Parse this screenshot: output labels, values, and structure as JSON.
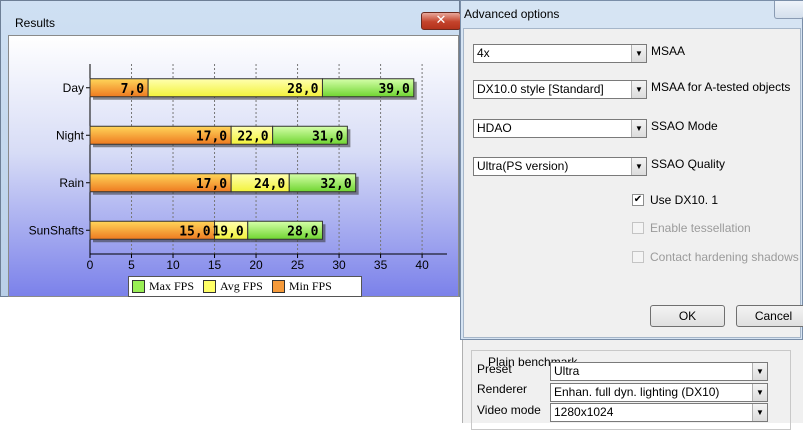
{
  "results_window": {
    "title": "Results",
    "close_glyph": "✕"
  },
  "chart_data": {
    "type": "bar",
    "orientation": "horizontal",
    "stacked": true,
    "categories": [
      "Day",
      "Night",
      "Rain",
      "SunShafts"
    ],
    "series": [
      {
        "name": "Min FPS",
        "values": [
          7.0,
          17.0,
          17.0,
          15.0
        ],
        "labels": [
          "7,0",
          "17,0",
          "17,0",
          "15,0"
        ],
        "color": "#f59a3a"
      },
      {
        "name": "Avg FPS",
        "values": [
          28.0,
          22.0,
          24.0,
          19.0
        ],
        "labels": [
          "28,0",
          "22,0",
          "24,0",
          "19,0"
        ],
        "color": "#ffff66"
      },
      {
        "name": "Max FPS",
        "values": [
          39.0,
          31.0,
          32.0,
          28.0
        ],
        "labels": [
          "39,0",
          "31,0",
          "32,0",
          "28,0"
        ],
        "color": "#99ee55"
      }
    ],
    "xlim": [
      0,
      43
    ],
    "xticks": [
      0,
      5,
      10,
      15,
      20,
      25,
      30,
      35,
      40
    ],
    "grid": true,
    "legend": {
      "position": "bottom",
      "entries": [
        "Max FPS",
        "Avg FPS",
        "Min FPS"
      ]
    }
  },
  "advanced_options": {
    "title": "Advanced options",
    "msaa": {
      "value": "4x",
      "label": "MSAA"
    },
    "msaa_atested": {
      "value": "DX10.0 style [Standard]",
      "label": "MSAA for A-tested objects"
    },
    "ssao_mode": {
      "value": "HDAO",
      "label": "SSAO Mode"
    },
    "ssao_quality": {
      "value": "Ultra(PS version)",
      "label": "SSAO Quality"
    },
    "use_dx101": {
      "label": "Use DX10. 1",
      "checked": true
    },
    "enable_tessellation": {
      "label": "Enable tessellation",
      "checked": false
    },
    "contact_hardening": {
      "label": "Contact hardening shadows",
      "checked": false
    },
    "ok_label": "OK",
    "cancel_label": "Cancel"
  },
  "plain_benchmark": {
    "group_label": "Plain benchmark",
    "preset": {
      "label": "Preset",
      "value": "Ultra"
    },
    "renderer": {
      "label": "Renderer",
      "value": "Enhan. full dyn. lighting (DX10)"
    },
    "video_mode": {
      "label": "Video mode",
      "value": "1280x1024"
    }
  }
}
